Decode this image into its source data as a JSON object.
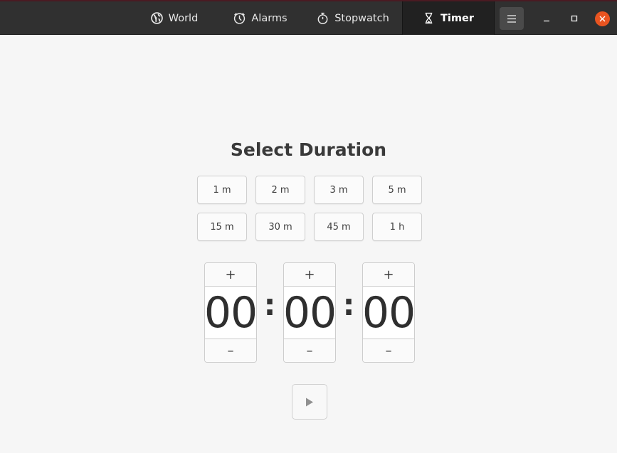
{
  "window": {
    "tabs": [
      {
        "label": "World",
        "icon": "globe-icon",
        "active": false
      },
      {
        "label": "Alarms",
        "icon": "alarm-clock-icon",
        "active": false
      },
      {
        "label": "Stopwatch",
        "icon": "stopwatch-icon",
        "active": false
      },
      {
        "label": "Timer",
        "icon": "hourglass-icon",
        "active": true
      }
    ],
    "controls": {
      "menu": "hamburger-menu-icon",
      "minimize": "minimize-icon",
      "maximize": "maximize-icon",
      "close": "close-icon"
    },
    "accent_close": "#e95420"
  },
  "timer": {
    "title": "Select Duration",
    "presets": [
      "1 m",
      "2 m",
      "3 m",
      "5 m",
      "15 m",
      "30 m",
      "45 m",
      "1 h"
    ],
    "hours": "00",
    "minutes": "00",
    "seconds": "00",
    "separator": ":",
    "plus_label": "+",
    "minus_label": "–",
    "start_icon": "play-icon",
    "start_enabled": false
  }
}
